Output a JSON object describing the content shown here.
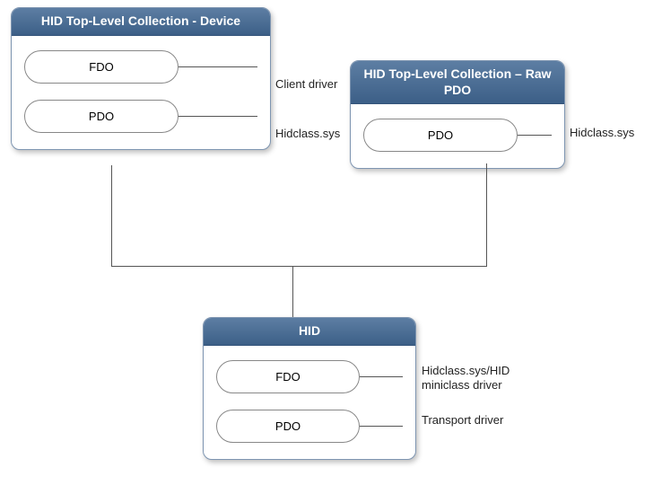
{
  "boxes": {
    "device": {
      "title": "HID Top-Level Collection - Device",
      "fdo": "FDO",
      "pdo": "PDO",
      "fdo_label": "Client driver",
      "pdo_label": "Hidclass.sys"
    },
    "rawpdo": {
      "title": "HID Top-Level Collection – Raw PDO",
      "pdo": "PDO",
      "pdo_label": "Hidclass.sys"
    },
    "hid": {
      "title": "HID",
      "fdo": "FDO",
      "pdo": "PDO",
      "fdo_label": "Hidclass.sys/HID miniclass driver",
      "pdo_label": "Transport driver"
    }
  }
}
